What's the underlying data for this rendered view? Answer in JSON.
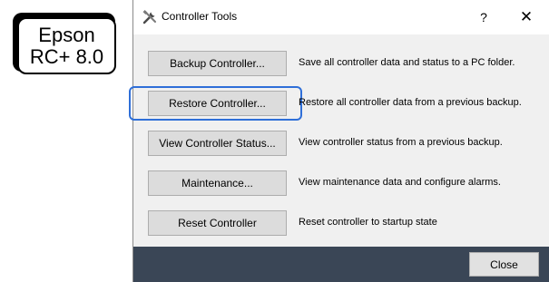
{
  "badge": {
    "line1": "Epson",
    "line2": "RC+ 8.0"
  },
  "window": {
    "title": "Controller Tools",
    "help_label": "?",
    "close_glyph": "✕",
    "icon": "tools-icon"
  },
  "actions": [
    {
      "label": "Backup Controller...",
      "description": "Save all controller data and status to a PC folder.",
      "highlighted": false
    },
    {
      "label": "Restore Controller...",
      "description": "Restore all controller data from a previous backup.",
      "highlighted": true
    },
    {
      "label": "View Controller Status...",
      "description": "View controller status from a previous backup.",
      "highlighted": false
    },
    {
      "label": "Maintenance...",
      "description": "View maintenance data and configure alarms.",
      "highlighted": false
    },
    {
      "label": "Reset Controller",
      "description": "Reset controller to startup state",
      "highlighted": false
    }
  ],
  "footer": {
    "close_label": "Close"
  },
  "colors": {
    "highlight_ring": "#2f6fd8",
    "dialog_body": "#f0f0f0",
    "footer_bar": "#3a4656"
  }
}
